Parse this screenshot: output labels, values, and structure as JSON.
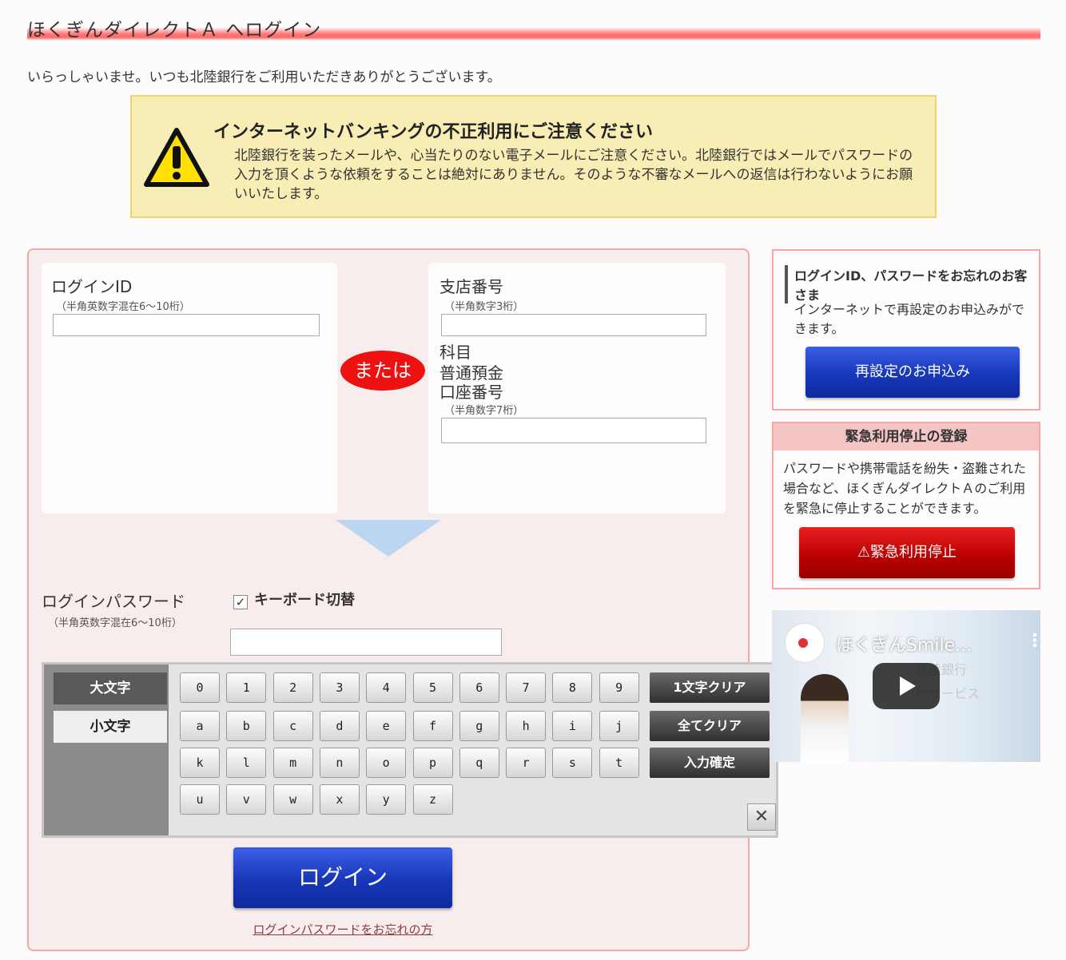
{
  "header": {
    "title": "ほくぎんダイレクトＡ へログイン",
    "welcome": "いらっしゃいませ。いつも北陸銀行をご利用いただきありがとうございます。"
  },
  "warning": {
    "title": "インターネットバンキングの不正利用にご注意ください",
    "body": "北陸銀行を装ったメールや、心当たりのない電子メールにご注意ください。北陸銀行ではメールでパスワードの入力を頂くような依頼をすることは絶対にありません。そのような不審なメールへの返信は行わないようにお願いいたします。",
    "icon": "warning-triangle-icon"
  },
  "login": {
    "id_label": "ログインID",
    "id_hint": "（半角英数字混在6～10桁）",
    "id_value": "",
    "or_label": "または",
    "branch_label": "支店番号",
    "branch_hint": "（半角数字3桁）",
    "branch_value": "",
    "subject_label": "科目",
    "subject_value": "普通預金",
    "account_label": "口座番号",
    "account_hint": "（半角数字7桁）",
    "account_value": "",
    "password_label": "ログインパスワード",
    "password_hint": "（半角英数字混在6～10桁）",
    "password_value": "",
    "keyboard_toggle_label": "キーボード切替",
    "keyboard_toggle_checked": true,
    "submit_label": "ログイン",
    "forgot_password_link": "ログインパスワードをお忘れの方"
  },
  "keyboard": {
    "upper_label": "大文字",
    "lower_label": "小文字",
    "active_case": "lower",
    "rows": [
      [
        "0",
        "1",
        "2",
        "3",
        "4",
        "5",
        "6",
        "7",
        "8",
        "9"
      ],
      [
        "a",
        "b",
        "c",
        "d",
        "e",
        "f",
        "g",
        "h",
        "i",
        "j"
      ],
      [
        "k",
        "l",
        "m",
        "n",
        "o",
        "p",
        "q",
        "r",
        "s",
        "t"
      ],
      [
        "u",
        "v",
        "w",
        "x",
        "y",
        "z"
      ]
    ],
    "clear_one_label": "1文字クリア",
    "clear_all_label": "全てクリア",
    "confirm_label": "入力確定",
    "close_label": "✕"
  },
  "forgot_id": {
    "title": "ログインID、パスワードをお忘れのお客さま",
    "body": "インターネットで再設定のお申込みができます。",
    "button_label": "再設定のお申込み"
  },
  "emergency": {
    "title": "緊急利用停止の登録",
    "body": "パスワードや携帯電話を紛失・盗難された場合など、ほくぎんダイレクトＡのご利用を緊急に停止することができます。",
    "button_label": "⚠緊急利用停止"
  },
  "video": {
    "title": "ほくぎんSmile...",
    "menu_icon": "⋮",
    "overlay_line1": "北陸銀行",
    "overlay_line2": "付サービス"
  },
  "colors": {
    "title_bar": "#ff4646",
    "warning_bg": "#f8eeb5",
    "panel_bg": "#f8eded",
    "panel_border": "#f3a7a7",
    "primary_button": "#1737b8",
    "danger_button": "#b80000",
    "or_badge": "#ee1111"
  }
}
